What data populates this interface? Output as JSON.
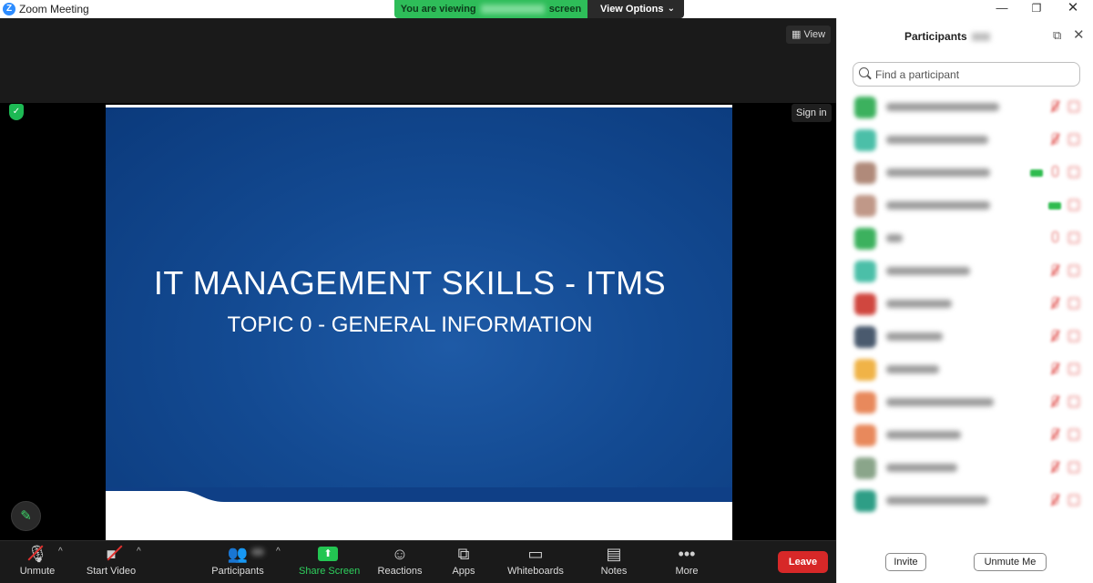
{
  "window": {
    "title": "Zoom Meeting",
    "minimize": "—",
    "maximize": "❐",
    "close": "✕"
  },
  "share_banner": {
    "viewing_prefix": "You are viewing",
    "viewing_suffix": "screen",
    "view_options": "View Options"
  },
  "stage": {
    "view_label": "View",
    "sign_in_label": "Sign in"
  },
  "slide": {
    "title": "IT MANAGEMENT SKILLS - ITMS",
    "subtitle": "TOPIC 0 - GENERAL INFORMATION"
  },
  "toolbar": {
    "unmute": "Unmute",
    "start_video": "Start Video",
    "participants": "Participants",
    "share_screen": "Share Screen",
    "reactions": "Reactions",
    "apps": "Apps",
    "whiteboards": "Whiteboards",
    "notes": "Notes",
    "more": "More",
    "leave": "Leave"
  },
  "panel": {
    "title": "Participants",
    "search_placeholder": "Find a participant",
    "invite": "Invite",
    "unmute_me": "Unmute Me"
  },
  "colors": {
    "accent_green": "#2ebd59",
    "leave_red": "#d72828",
    "slide_blue": "#134a92",
    "muted_red": "#e0504d"
  }
}
